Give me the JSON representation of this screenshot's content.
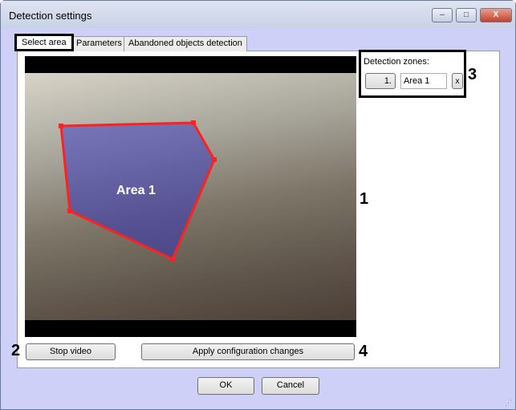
{
  "window": {
    "title": "Detection settings",
    "minimize": "‒",
    "maximize": "□",
    "close": "X"
  },
  "tabs": [
    {
      "label": "Select area"
    },
    {
      "label": "Parameters"
    },
    {
      "label": "Abandoned objects detection"
    }
  ],
  "video": {
    "area_label": "Area 1",
    "polygon_color": "#ff2020"
  },
  "zones": {
    "label": "Detection zones:",
    "zone_button": "1.",
    "zone_name": "Area 1",
    "delete": "x"
  },
  "buttons": {
    "stop_video": "Stop video",
    "apply": "Apply configuration changes",
    "ok": "OK",
    "cancel": "Cancel"
  },
  "annotations": [
    "1",
    "2",
    "3",
    "4"
  ]
}
